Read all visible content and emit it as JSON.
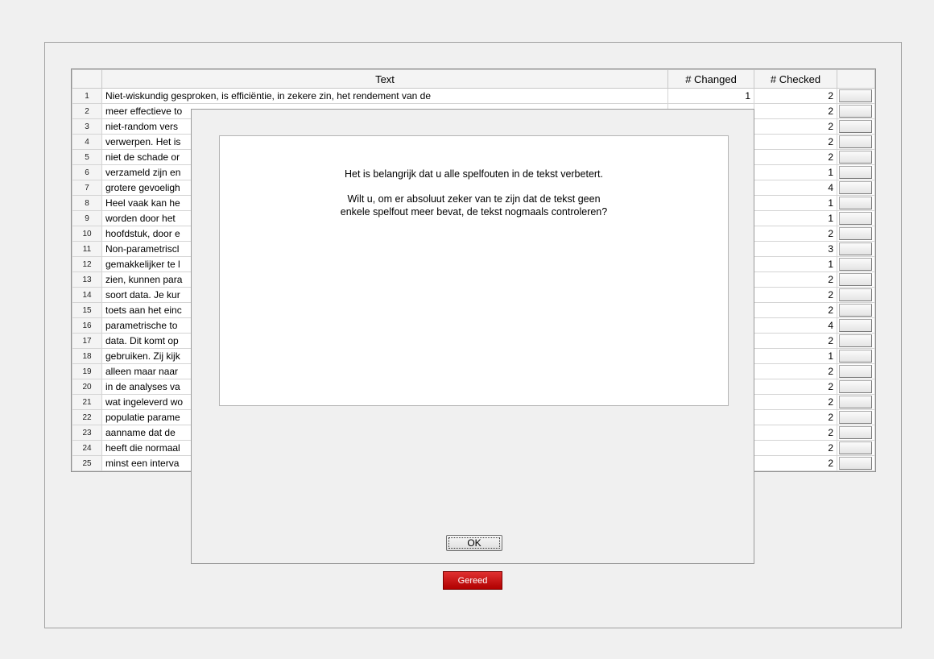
{
  "table": {
    "headers": {
      "text": "Text",
      "changed": "# Changed",
      "checked": "# Checked"
    },
    "rows": [
      {
        "n": "1",
        "text": "Niet-wiskundig gesproken, is efficiëntie, in zekere zin, het rendement van de",
        "changed": "1",
        "checked": "2"
      },
      {
        "n": "2",
        "text": "meer effectieve to",
        "changed": "",
        "checked": "2"
      },
      {
        "n": "3",
        "text": "niet-random vers",
        "changed": "",
        "checked": "2"
      },
      {
        "n": "4",
        "text": "verwerpen. Het is",
        "changed": "",
        "checked": "2"
      },
      {
        "n": "5",
        "text": "niet de schade or",
        "changed": "",
        "checked": "2"
      },
      {
        "n": "6",
        "text": "verzameld zijn en",
        "changed": "",
        "checked": "1"
      },
      {
        "n": "7",
        "text": "grotere gevoeligh",
        "changed": "",
        "checked": "4"
      },
      {
        "n": "8",
        "text": "Heel vaak kan he",
        "changed": "",
        "checked": "1"
      },
      {
        "n": "9",
        "text": "worden door het",
        "changed": "",
        "checked": "1"
      },
      {
        "n": "10",
        "text": "hoofdstuk, door e",
        "changed": "",
        "checked": "2"
      },
      {
        "n": "11",
        "text": "Non-parametriscl",
        "changed": "",
        "checked": "3"
      },
      {
        "n": "12",
        "text": "gemakkelijker te l",
        "changed": "",
        "checked": "1"
      },
      {
        "n": "13",
        "text": "zien, kunnen para",
        "changed": "",
        "checked": "2"
      },
      {
        "n": "14",
        "text": "soort data. Je kur",
        "changed": "",
        "checked": "2"
      },
      {
        "n": "15",
        "text": "toets aan het einc",
        "changed": "",
        "checked": "2"
      },
      {
        "n": "16",
        "text": "parametrische to",
        "changed": "",
        "checked": "4"
      },
      {
        "n": "17",
        "text": "data. Dit komt op",
        "changed": "",
        "checked": "2"
      },
      {
        "n": "18",
        "text": "gebruiken. Zij kijk",
        "changed": "",
        "checked": "1"
      },
      {
        "n": "19",
        "text": "alleen maar naar",
        "changed": "",
        "checked": "2"
      },
      {
        "n": "20",
        "text": "in de analyses va",
        "changed": "",
        "checked": "2"
      },
      {
        "n": "21",
        "text": "wat ingeleverd wo",
        "changed": "",
        "checked": "2"
      },
      {
        "n": "22",
        "text": "populatie parame",
        "changed": "",
        "checked": "2"
      },
      {
        "n": "23",
        "text": "aanname dat de",
        "changed": "",
        "checked": "2"
      },
      {
        "n": "24",
        "text": "heeft die normaal",
        "changed": "",
        "checked": "2"
      },
      {
        "n": "25",
        "text": "minst een interva",
        "changed": "",
        "checked": "2"
      }
    ]
  },
  "dialog": {
    "message_line1": "Het is belangrijk dat u alle spelfouten in de tekst verbetert.",
    "message_line2a": "Wilt u, om er absoluut zeker van te zijn dat de tekst geen",
    "message_line2b": "enkele spelfout meer bevat, de tekst nogmaals controleren?",
    "ok_label": "OK"
  },
  "footer": {
    "done_label": "Gereed",
    "done_color": "#cc1111"
  }
}
